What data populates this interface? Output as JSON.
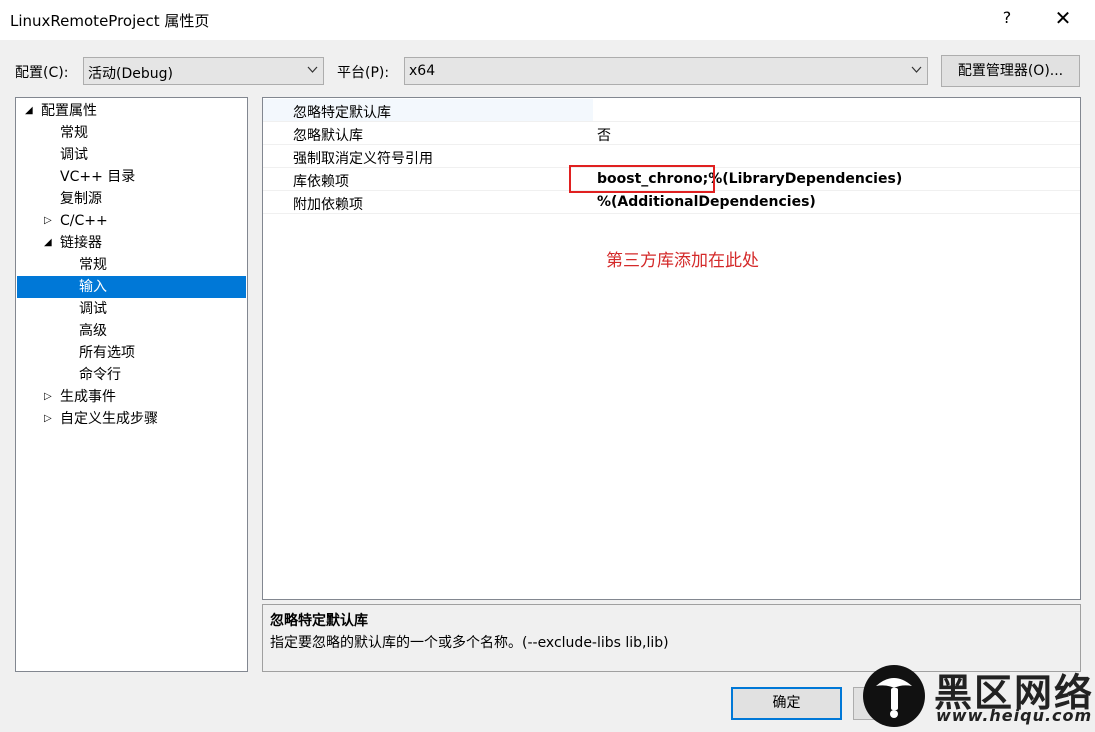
{
  "window": {
    "title": "LinuxRemoteProject 属性页",
    "help_label": "?",
    "close_label": "✕"
  },
  "toolbar": {
    "config_label": "配置(C):",
    "config_value": "活动(Debug)",
    "platform_label": "平台(P):",
    "platform_value": "x64",
    "config_manager_label": "配置管理器(O)..."
  },
  "tree": {
    "items": [
      {
        "label": "配置属性",
        "expander": "◢"
      },
      {
        "label": "常规"
      },
      {
        "label": "调试"
      },
      {
        "label": "VC++ 目录"
      },
      {
        "label": "复制源"
      },
      {
        "label": "C/C++",
        "expander": "▷"
      },
      {
        "label": "链接器",
        "expander": "◢"
      },
      {
        "label": "常规"
      },
      {
        "label": "输入"
      },
      {
        "label": "调试"
      },
      {
        "label": "高级"
      },
      {
        "label": "所有选项"
      },
      {
        "label": "命令行"
      },
      {
        "label": "生成事件",
        "expander": "▷"
      },
      {
        "label": "自定义生成步骤",
        "expander": "▷"
      }
    ]
  },
  "properties": {
    "rows": [
      {
        "name": "忽略特定默认库",
        "value": ""
      },
      {
        "name": "忽略默认库",
        "value": "否"
      },
      {
        "name": "强制取消定义符号引用",
        "value": ""
      },
      {
        "name": "库依赖项",
        "value": "boost_chrono;%(LibraryDependencies)"
      },
      {
        "name": "附加依赖项",
        "value": "%(AdditionalDependencies)"
      }
    ]
  },
  "annotation": {
    "text": "第三方库添加在此处",
    "color": "#e02020"
  },
  "description": {
    "title": "忽略特定默认库",
    "text": "指定要忽略的默认库的一个或多个名称。(--exclude-libs lib,lib)"
  },
  "footer": {
    "ok_label": "确定"
  },
  "watermark": {
    "brand": "黑区网络",
    "url": "www.heiqu.com"
  },
  "colors": {
    "selection": "#0078d7",
    "annotation": "#e02020"
  }
}
